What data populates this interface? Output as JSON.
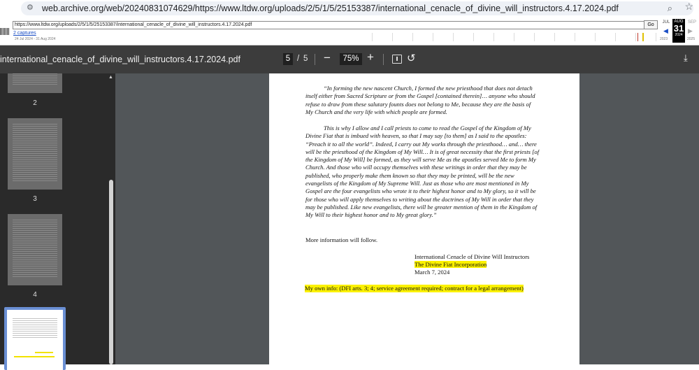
{
  "browser": {
    "url": "web.archive.org/web/20240831074629/https://www.ltdw.org/uploads/2/5/1/5/25153387/international_cenacle_of_divine_will_instructors.4.17.2024.pdf"
  },
  "wayback": {
    "url": "https://www.ltdw.org/uploads/2/5/1/5/25153387/international_cenacle_of_divine_will_instructors.4.17.2024.pdf",
    "go_label": "Go",
    "captures": "2 captures",
    "range": "24 Jul 2024 - 31 Aug 2024",
    "prev_month": "JUL",
    "cur_month": "AUG",
    "next_month": "SEP",
    "cur_day": "31",
    "prev_year": "2023",
    "cur_year": "2024",
    "next_year": "2025",
    "logo_text": "INTERNET ARCHIVE"
  },
  "pdf": {
    "title": "international_cenacle_of_divine_will_instructors.4.17.2024.pdf",
    "current_page": "5",
    "separator": "/",
    "total_pages": "5",
    "zoom": "75%",
    "thumbnails": [
      {
        "label": "2"
      },
      {
        "label": "3"
      },
      {
        "label": "4"
      }
    ],
    "paragraph1": [
      "“In forming the new nascent Church, I formed the new priesthood that does not detach",
      "itself either from Sacred Scripture or from the Gospel [contained therein]… anyone who should",
      "refuse to draw from these salutary founts does not belong to Me, because they are the basis of",
      "My Church and the very life with which people are formed."
    ],
    "paragraph2": [
      "This is why I allow and I call priests to come to read the Gospel of the Kingdom of My",
      "Divine Fiat that is imbued with heaven, so that I may say [to them] as I said to the apostles:",
      "“Preach it to all the world”. Indeed, I carry out My works through the priesthood… and… there",
      "will be the priesthood of the Kingdom of My Will… It is of great necessity that the first priests [of",
      "the Kingdom of My Will] be formed, as they will serve Me as the apostles served Me to form My",
      "Church. And those who will occupy themselves with these writings in order that they may be",
      "published, who properly make them known so that they may be printed, will be the new",
      "evangelists of the Kingdom of My Supreme Will. Just as those who are most mentioned in My",
      "Gospel are the four evangelists who wrote it to their highest honor and to My glory, so it will be",
      "for those who will apply themselves to writing about the doctrines of My Will in order that they",
      "may be published. Like new evangelists, there will be greater mention of them in the Kingdom of",
      "My Will to their highest honor and to My great glory.”"
    ],
    "more_info": "More information will follow.",
    "sig_line1": "International Cenacle of Divine Will Instructors",
    "sig_line2": "The Divine Fiat Incorporation",
    "sig_line3": "March 7, 2024",
    "own_info": "My own info: (DFI arts. 3; 4; service agreement required; contract for a legal arrangement)"
  },
  "colors": {
    "highlight": "#fbf100",
    "viewer_bg": "#525659",
    "toolbar_bg": "#3c3c3c"
  }
}
